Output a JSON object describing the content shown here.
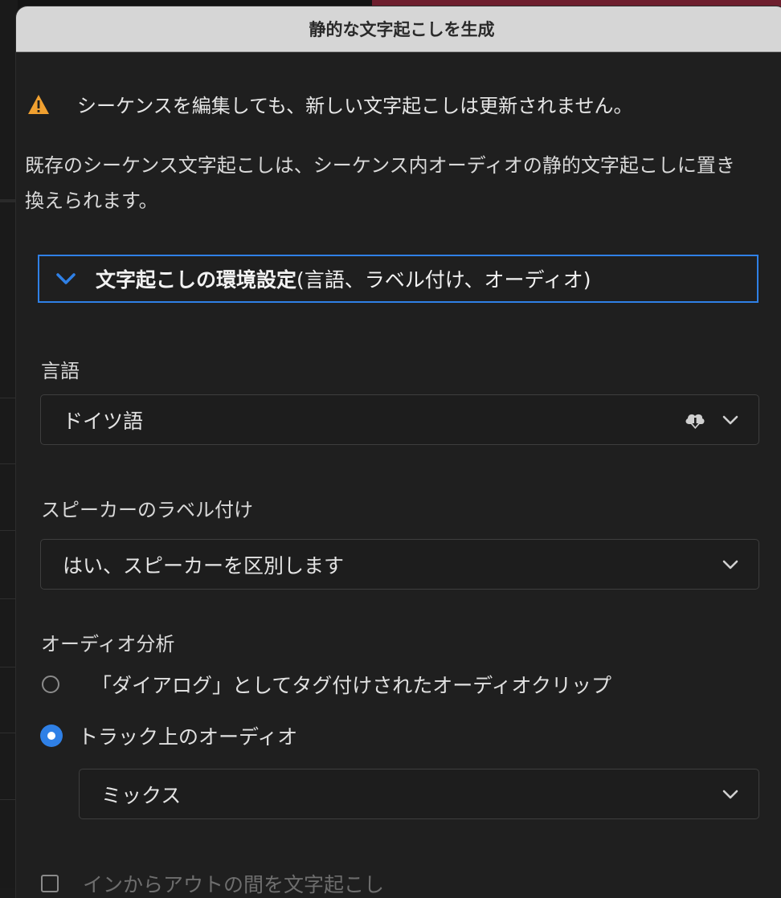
{
  "dialog": {
    "title": "静的な文字起こしを生成"
  },
  "warning": {
    "icon": "warning-icon",
    "color": "#f0a030",
    "text": "シーケンスを編集しても、新しい文字起こしは更新されません。"
  },
  "description": "既存のシーケンス文字起こしは、シーケンス内オーディオの静的文字起こしに置き換えられます。",
  "preferences": {
    "title_bold": "文字起こしの環境設定",
    "title_rest": " (言語、ラベル付け、オーディオ)",
    "accent": "#2f80e6"
  },
  "language": {
    "label": "言語",
    "selected": "ドイツ語"
  },
  "speaker_labeling": {
    "label": "スピーカーのラベル付け",
    "selected": "はい、スピーカーを区別します"
  },
  "audio_analysis": {
    "label": "オーディオ分析",
    "option_dialog": "「ダイアログ」としてタグ付けされたオーディオクリップ",
    "option_tracks": "トラック上のオーディオ",
    "selected_option": "option_tracks",
    "mix_selected": "ミックス"
  },
  "in_out": {
    "label": "インからアウトの間を文字起こし",
    "checked": false
  }
}
